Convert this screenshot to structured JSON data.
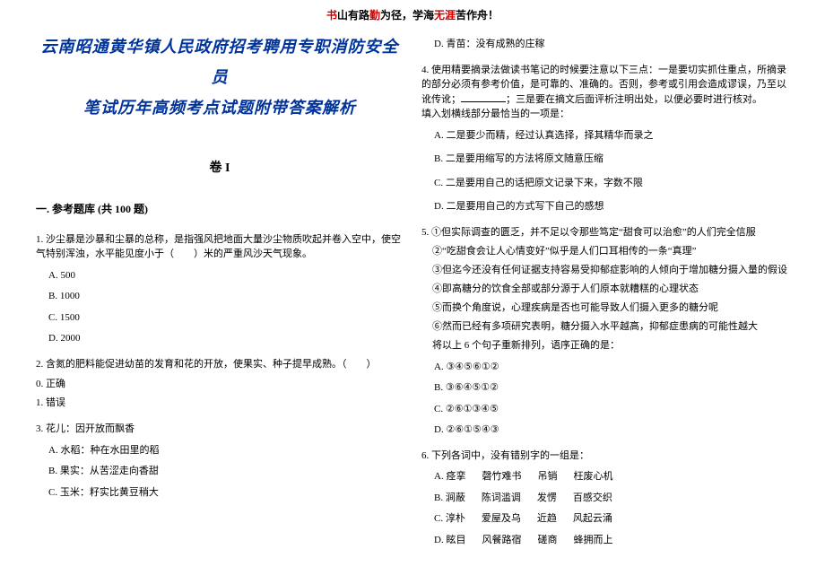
{
  "header": {
    "p1a": "书",
    "p1b": "山有路",
    "p1c": "勤",
    "p1d": "为径，学海",
    "p1e": "无涯",
    "p1f": "苦作舟！"
  },
  "title": {
    "line1": "云南昭通黄华镇人民政府招考聘用专职消防安全员",
    "line2": "笔试历年高频考点试题附带答案解析"
  },
  "juan": "卷 I",
  "section1": "一. 参考题库 (共 100 题)",
  "q1": {
    "stem": "1. 沙尘暴是沙暴和尘暴的总称，是指强风把地面大量沙尘物质吹起并卷入空中，使空气特别浑浊，水平能见度小于（　　）米的严重风沙天气现象。",
    "a": "A. 500",
    "b": "B. 1000",
    "c": "C. 1500",
    "d": "D. 2000"
  },
  "q2": {
    "stem": "2. 含氮的肥料能促进幼苗的发育和花的开放，使果实、种子提早成熟。（　　）",
    "a": "0. 正确",
    "b": "1. 错误"
  },
  "q3": {
    "stem": "3. 花儿：因开放而飘香",
    "a": "A. 水稻：种在水田里的稻",
    "b": "B. 果实：从苦涩走向香甜",
    "c": "C. 玉米：籽实比黄豆稍大",
    "d": "D. 青苗：没有成熟的庄稼"
  },
  "q4": {
    "stem_l1": "4. 使用精要摘录法做读书笔记的时候要注意以下三点：一是要切实抓住重点，所摘录的部分必须有参考价值，是可靠的、准确的。否则，参考或引用会造成谬误，乃至以讹传讹；",
    "stem_l2": "；三是要在摘文后面评析注明出处，以便必要时进行核对。",
    "stem_l3": "填入划横线部分最恰当的一项是：",
    "a": "A. 二是要少而精，经过认真选择，择其精华而录之",
    "b": "B. 二是要用缩写的方法将原文随意压缩",
    "c": "C. 二是要用自己的话把原文记录下来，字数不限",
    "d": "D. 二是要用自己的方式写下自己的感想"
  },
  "q5": {
    "l1": "5. ①但实际调查的匮乏，并不足以令那些笃定“甜食可以治愈”的人们完全信服",
    "l2": "②“吃甜食会让人心情变好”似乎是人们口耳相传的一条“真理”",
    "l3": "③但迄今还没有任何证据支持容易受抑郁症影响的人倾向于增加糖分摄入量的假设",
    "l4": "④即高糖分的饮食全部或部分源于人们原本就糟糕的心理状态",
    "l5": "⑤而换个角度说，心理疾病是否也可能导致人们摄入更多的糖分呢",
    "l6": "⑥然而已经有多项研究表明，糖分摄入水平越高，抑郁症患病的可能性越大",
    "l7": "将以上 6 个句子重新排列，语序正确的是：",
    "a": "A. ③④⑤⑥①②",
    "b": "B. ③⑥④⑤①②",
    "c": "C. ②⑥①③④⑤",
    "d": "D. ②⑥①⑤④③"
  },
  "q6": {
    "stem": "6. 下列各词中，没有错别字的一组是：",
    "a": {
      "lbl": "A. 痉挛",
      "w1": "磬竹难书",
      "w2": "吊销",
      "w3": "枉废心机"
    },
    "b": {
      "lbl": "B. 涧蔽",
      "w1": "陈词滥调",
      "w2": "发愣",
      "w3": "百感交织"
    },
    "c": {
      "lbl": "C. 淳朴",
      "w1": "爱屋及乌",
      "w2": "近趋",
      "w3": "风起云涌"
    },
    "d": {
      "lbl": "D. 眩目",
      "w1": "风餐路宿",
      "w2": "磋商",
      "w3": "蜂拥而上"
    }
  }
}
